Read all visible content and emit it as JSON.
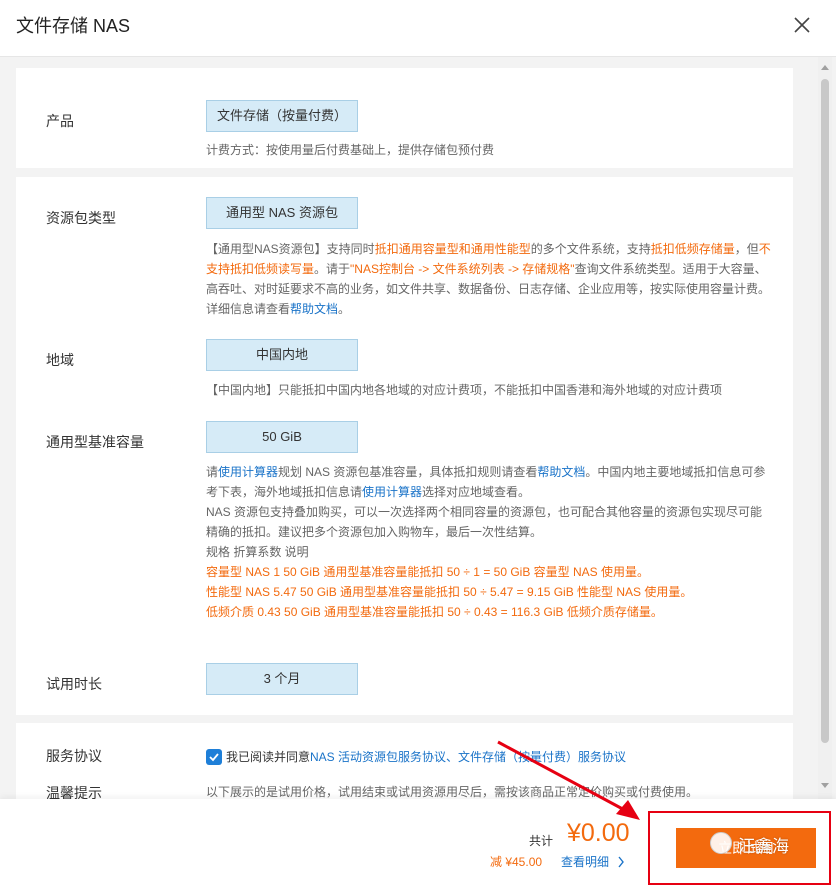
{
  "header": {
    "title": "文件存储 NAS",
    "close_icon": "close-icon"
  },
  "product": {
    "label": "产品",
    "value": "文件存储（按量付费）",
    "note": "计费方式：按使用量后付费基础上，提供存储包预付费"
  },
  "package_type": {
    "label": "资源包类型",
    "value": "通用型 NAS 资源包",
    "desc_parts": {
      "p1": "【通用型NAS资源包】支持同时",
      "p2": "抵扣通用容量型和通用性能型",
      "p3": "的多个文件系统，支持",
      "p4": "抵扣低频存储量",
      "p5": "，但",
      "p6": "不支持抵扣低频读写量",
      "p7": "。请于",
      "p8": "\"NAS控制台 -> 文件系统列表 -> 存储规格\"",
      "p9": "查询文件系统类型。适用于大容量、高吞吐、对时延要求不高的业务，如文件共享、数据备份、日志存储、企业应用等，按实际使用容量计费。详细信息请查看",
      "p10": "帮助文档",
      "p11": "。"
    }
  },
  "region": {
    "label": "地域",
    "value": "中国内地",
    "note": "【中国内地】只能抵扣中国内地各地域的对应计费项，不能抵扣中国香港和海外地域的对应计费项"
  },
  "capacity": {
    "label": "通用型基准容量",
    "value": "50 GiB",
    "desc": {
      "a1": "请",
      "a2": "使用计算器",
      "a3": "规划 NAS 资源包基准容量，具体抵扣规则请查看",
      "a4": "帮助文档",
      "a5": "。中国内地主要地域抵扣信息可参考下表，海外地域抵扣信息请",
      "a6": "使用计算器",
      "a7": "选择对应地域查看。",
      "b1": "NAS 资源包支持叠加购买，可以一次选择两个相同容量的资源包，也可配合其他容量的资源包实现尽可能精确的抵扣。建议把多个资源包加入购物车，最后一次性结算。",
      "table_header": "规格 折算系数 说明",
      "row1": "容量型 NAS 1 50 GiB 通用型基准容量能抵扣 50 ÷ 1 = 50 GiB 容量型 NAS 使用量。",
      "row2": "性能型 NAS 5.47 50 GiB 通用型基准容量能抵扣 50 ÷ 5.47 = 9.15 GiB 性能型 NAS 使用量。",
      "row3": "低频介质 0.43 50 GiB 通用型基准容量能抵扣 50 ÷ 0.43 = 116.3 GiB 低频介质存储量。"
    }
  },
  "trial": {
    "label": "试用时长",
    "value": "3 个月"
  },
  "agreement": {
    "label": "服务协议",
    "checked": true,
    "prefix": "我已阅读并同意",
    "link": "NAS 活动资源包服务协议、文件存储（按量付费）服务协议"
  },
  "tips": {
    "label": "温馨提示",
    "text": "以下展示的是试用价格，试用结束或试用资源用尽后，需按该商品正常定价购买或付费使用。"
  },
  "footer": {
    "total_label": "共计",
    "price": "¥0.00",
    "discount": "减 ¥45.00",
    "detail_link": "查看明细",
    "button": "立即试用",
    "watermark": "汪鑫海"
  },
  "colors": {
    "accent": "#f36a0e",
    "link": "#1a73c8",
    "highlight_box": "#e60012",
    "pill_bg": "#d6ebf7"
  }
}
